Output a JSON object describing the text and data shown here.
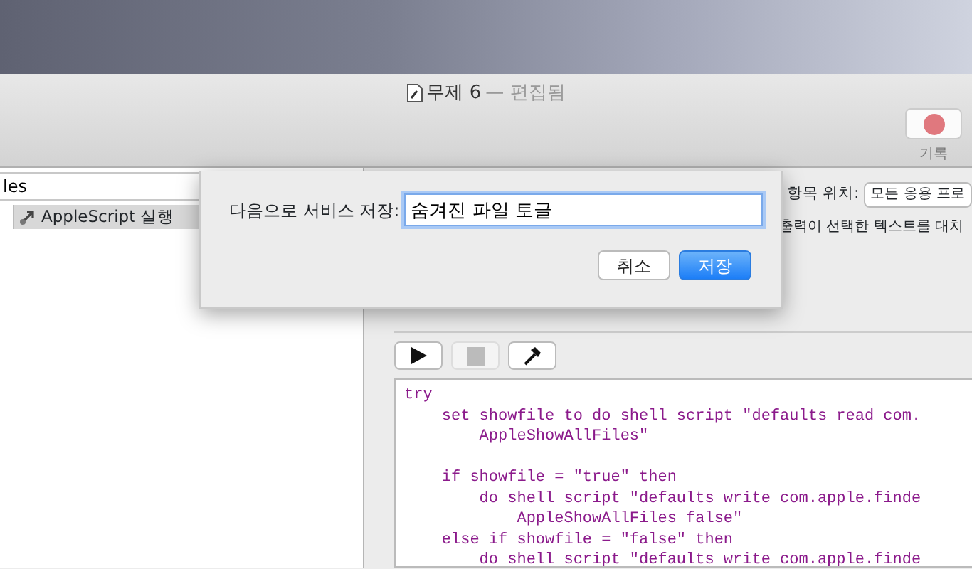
{
  "window": {
    "title": "무제 6",
    "status": "— 편집됨"
  },
  "toolbar": {
    "record_label": "기록"
  },
  "sidebar": {
    "search_value": "les",
    "items": [
      {
        "label": "AppleScript 실행",
        "selected": true
      }
    ]
  },
  "workflow": {
    "location_label": "항목 위치:",
    "location_value": "모든 응용 프로",
    "output_text": "출력이 선택한 텍스트를 대치",
    "controls": [
      {
        "kind": "run",
        "disabled": false
      },
      {
        "kind": "stop",
        "disabled": true
      },
      {
        "kind": "compile",
        "disabled": false
      }
    ],
    "code": [
      [
        "try",
        "    set showfile to do shell script \"defaults read com.",
        "        AppleShowAllFiles\""
      ],
      [
        "    if showfile = \"true\" then",
        "        do shell script \"defaults write com.apple.finde",
        "            AppleShowAllFiles false\"",
        "    else if showfile = \"false\" then",
        "        do shell script \"defaults write com.apple.finde"
      ]
    ]
  },
  "dialog": {
    "label": "다음으로 서비스 저장:",
    "value": "숨겨진 파일 토글",
    "buttons": [
      {
        "label": "취소",
        "kind": "cancel"
      },
      {
        "label": "저장",
        "kind": "default"
      }
    ]
  }
}
